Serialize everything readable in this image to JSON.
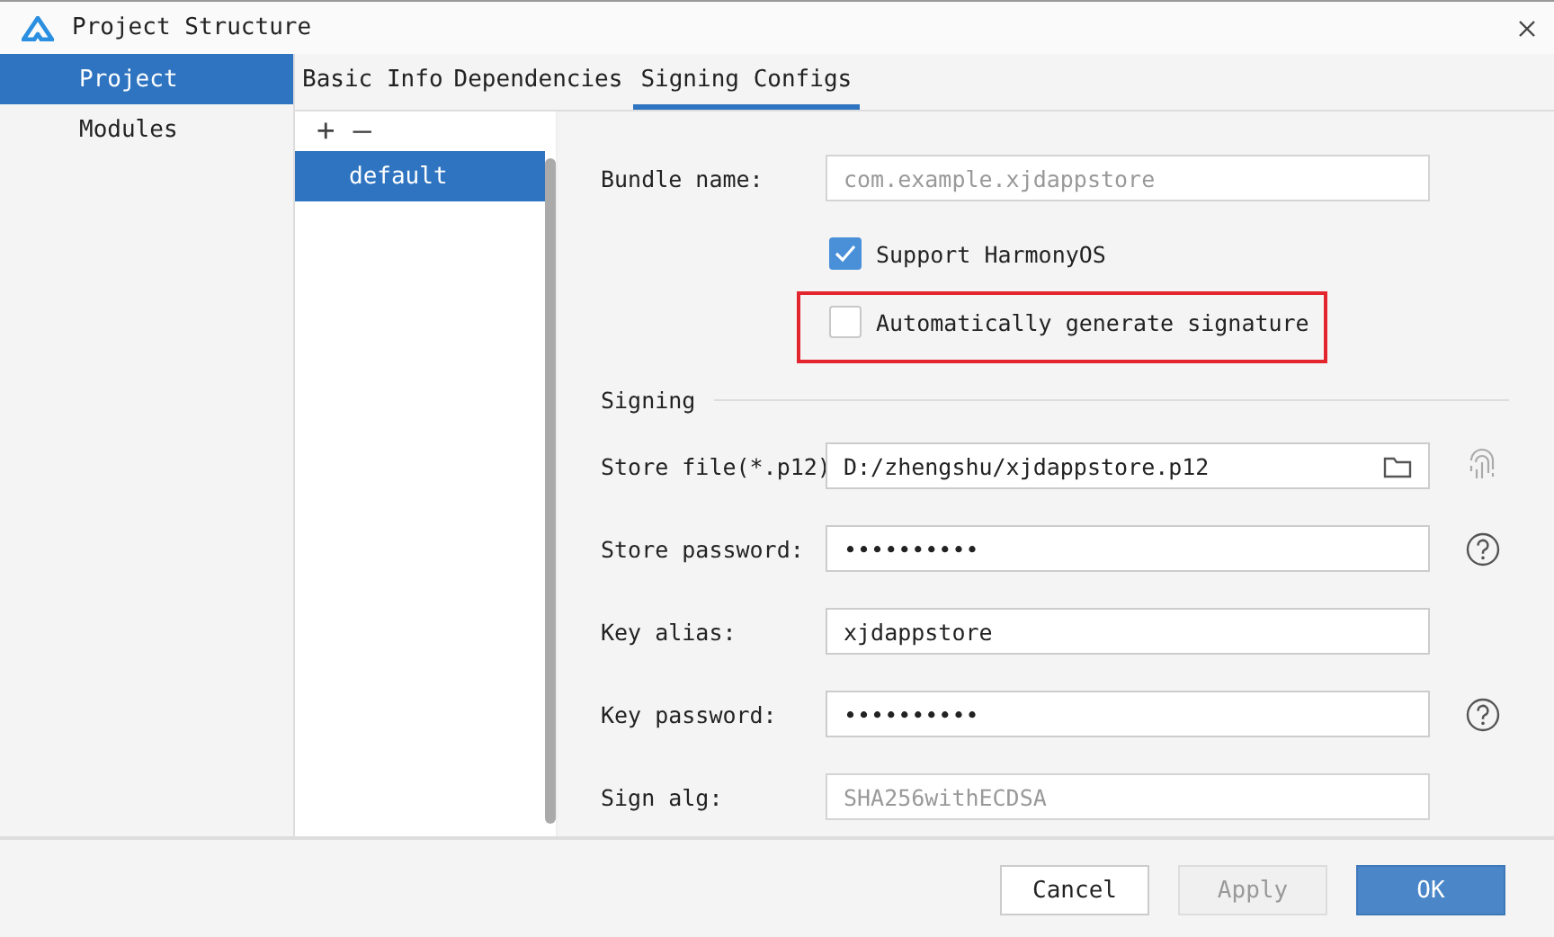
{
  "window": {
    "title": "Project Structure"
  },
  "sidebar": {
    "items": [
      {
        "label": "Project",
        "selected": true
      },
      {
        "label": "Modules",
        "selected": false
      }
    ]
  },
  "tabs": [
    {
      "label": "Basic Info",
      "selected": false
    },
    {
      "label": "Dependencies",
      "selected": false
    },
    {
      "label": "Signing Configs",
      "selected": true
    }
  ],
  "configs": {
    "add": "+",
    "remove": "—",
    "items": [
      {
        "label": "default",
        "selected": true
      }
    ]
  },
  "bundle": {
    "label": "Bundle name:",
    "value": "com.example.xjdappstore",
    "disabled": true
  },
  "options": [
    {
      "label": "Support HarmonyOS",
      "checked": true,
      "highlighted": false
    },
    {
      "label": "Automatically generate signature",
      "checked": false,
      "highlighted": true
    }
  ],
  "signing": {
    "title": "Signing",
    "fields": [
      {
        "kind": "file",
        "label": "Store file(*.p12)",
        "value": "D:/zhengshu/xjdappstore.p12",
        "disabled": false
      },
      {
        "kind": "password",
        "label": "Store password:",
        "value": "••••••••••",
        "disabled": false
      },
      {
        "kind": "text",
        "label": "Key alias:",
        "value": "xjdappstore",
        "disabled": false
      },
      {
        "kind": "password",
        "label": "Key password:",
        "value": "••••••••••",
        "disabled": false
      },
      {
        "kind": "text",
        "label": "Sign alg:",
        "value": "SHA256withECDSA",
        "disabled": true
      }
    ]
  },
  "buttons": [
    {
      "label": "Cancel",
      "kind": "normal",
      "disabled": false
    },
    {
      "label": "Apply",
      "kind": "normal",
      "disabled": true
    },
    {
      "label": "OK",
      "kind": "primary",
      "disabled": false
    }
  ]
}
